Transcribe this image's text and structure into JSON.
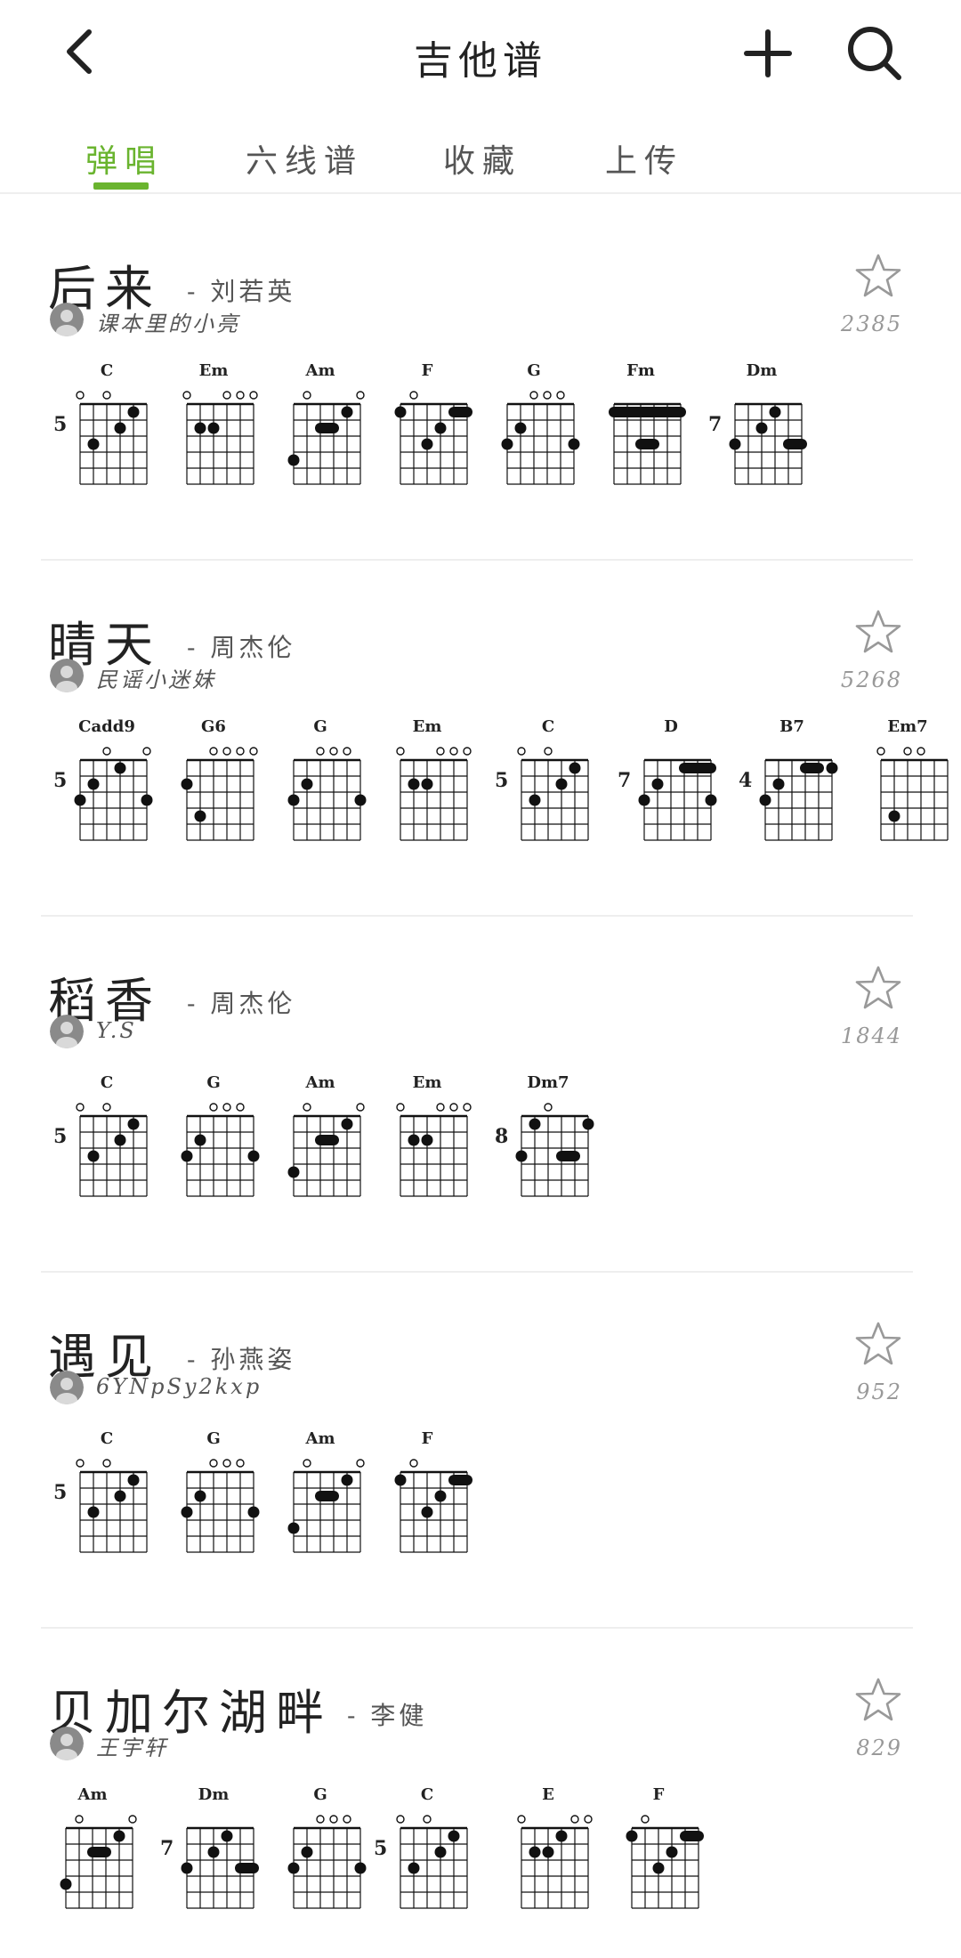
{
  "header": {
    "title": "吉他谱",
    "back_icon": "chevron-left-icon",
    "add_icon": "plus-icon",
    "search_icon": "search-icon"
  },
  "tabs": [
    {
      "label": "弹唱",
      "active": true
    },
    {
      "label": "六线谱",
      "active": false
    },
    {
      "label": "收藏",
      "active": false
    },
    {
      "label": "上传",
      "active": false
    }
  ],
  "colors": {
    "accent": "#6ab42f",
    "divider": "#eeeeee"
  },
  "songs": [
    {
      "title": "后来",
      "artist": "- 刘若英",
      "uploader": "课本里的小亮",
      "count": "2385",
      "chords": [
        {
          "name": "C",
          "fret": "5"
        },
        {
          "name": "Em",
          "fret": ""
        },
        {
          "name": "Am",
          "fret": ""
        },
        {
          "name": "F",
          "fret": ""
        },
        {
          "name": "G",
          "fret": ""
        },
        {
          "name": "Fm",
          "fret": ""
        },
        {
          "name": "Dm",
          "fret": "7"
        }
      ]
    },
    {
      "title": "晴天",
      "artist": "- 周杰伦",
      "uploader": "民谣小迷妹",
      "count": "5268",
      "chords": [
        {
          "name": "Cadd9",
          "fret": "5"
        },
        {
          "name": "G6",
          "fret": ""
        },
        {
          "name": "G",
          "fret": ""
        },
        {
          "name": "Em",
          "fret": ""
        },
        {
          "name": "C",
          "fret": "5"
        },
        {
          "name": "D",
          "fret": "7"
        },
        {
          "name": "B7",
          "fret": "4"
        },
        {
          "name": "Em7",
          "fret": ""
        }
      ]
    },
    {
      "title": "稻香",
      "artist": "- 周杰伦",
      "uploader": "Y.S",
      "count": "1844",
      "chords": [
        {
          "name": "C",
          "fret": "5"
        },
        {
          "name": "G",
          "fret": ""
        },
        {
          "name": "Am",
          "fret": ""
        },
        {
          "name": "Em",
          "fret": ""
        },
        {
          "name": "Dm7",
          "fret": "8"
        }
      ]
    },
    {
      "title": "遇见",
      "artist": "- 孙燕姿",
      "uploader": "6YNpSy2kxp",
      "count": "952",
      "chords": [
        {
          "name": "C",
          "fret": "5"
        },
        {
          "name": "G",
          "fret": ""
        },
        {
          "name": "Am",
          "fret": ""
        },
        {
          "name": "F",
          "fret": ""
        }
      ]
    },
    {
      "title": "贝加尔湖畔",
      "artist": "- 李健",
      "uploader": "王宇轩",
      "count": "829",
      "chords": [
        {
          "name": "Am",
          "fret": ""
        },
        {
          "name": "Dm",
          "fret": "7"
        },
        {
          "name": "G",
          "fret": ""
        },
        {
          "name": "C",
          "fret": "5"
        },
        {
          "name": "E",
          "fret": ""
        },
        {
          "name": "F",
          "fret": ""
        }
      ]
    }
  ]
}
